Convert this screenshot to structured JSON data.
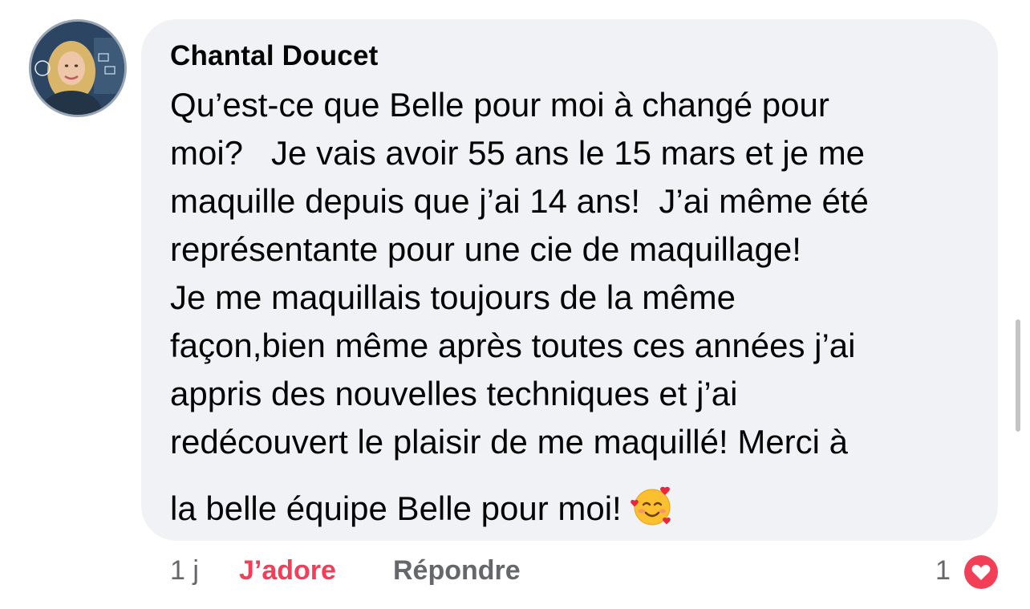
{
  "comment": {
    "author": "Chantal Doucet",
    "lines": [
      "Qu’est-ce que Belle pour moi à changé pour",
      "moi?   Je vais avoir 55 ans le 15 mars et je me",
      "maquille depuis que j’ai 14 ans!  J’ai même été",
      "représentante pour une cie de maquillage!",
      "Je me maquillais toujours de la même",
      "façon,bien même après toutes ces années j’ai",
      "appris des nouvelles techniques et j’ai",
      "redécouvert le plaisir de me maquillé! Merci à",
      "la belle équipe Belle pour moi!"
    ],
    "emoji": "smiling-face-with-hearts-icon"
  },
  "actions": {
    "time": "1 j",
    "like_label": "J’adore",
    "reply_label": "Répondre",
    "reaction_count": "1",
    "reaction_icon": "love-heart-icon"
  },
  "colors": {
    "bubble": "#f0f2f5",
    "like_active": "#f33e58",
    "secondary_text": "#65676b",
    "love_reaction": "#f33e58"
  }
}
